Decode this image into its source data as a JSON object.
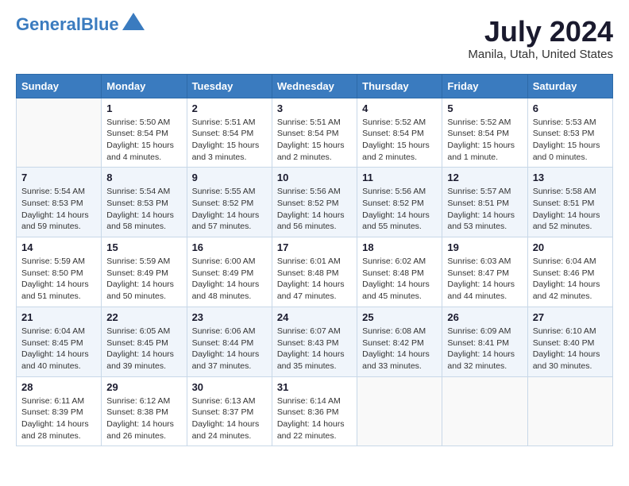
{
  "header": {
    "logo_general": "General",
    "logo_blue": "Blue",
    "month_year": "July 2024",
    "location": "Manila, Utah, United States"
  },
  "weekdays": [
    "Sunday",
    "Monday",
    "Tuesday",
    "Wednesday",
    "Thursday",
    "Friday",
    "Saturday"
  ],
  "weeks": [
    [
      {
        "day": "",
        "sunrise": "",
        "sunset": "",
        "daylight": ""
      },
      {
        "day": "1",
        "sunrise": "Sunrise: 5:50 AM",
        "sunset": "Sunset: 8:54 PM",
        "daylight": "Daylight: 15 hours and 4 minutes."
      },
      {
        "day": "2",
        "sunrise": "Sunrise: 5:51 AM",
        "sunset": "Sunset: 8:54 PM",
        "daylight": "Daylight: 15 hours and 3 minutes."
      },
      {
        "day": "3",
        "sunrise": "Sunrise: 5:51 AM",
        "sunset": "Sunset: 8:54 PM",
        "daylight": "Daylight: 15 hours and 2 minutes."
      },
      {
        "day": "4",
        "sunrise": "Sunrise: 5:52 AM",
        "sunset": "Sunset: 8:54 PM",
        "daylight": "Daylight: 15 hours and 2 minutes."
      },
      {
        "day": "5",
        "sunrise": "Sunrise: 5:52 AM",
        "sunset": "Sunset: 8:54 PM",
        "daylight": "Daylight: 15 hours and 1 minute."
      },
      {
        "day": "6",
        "sunrise": "Sunrise: 5:53 AM",
        "sunset": "Sunset: 8:53 PM",
        "daylight": "Daylight: 15 hours and 0 minutes."
      }
    ],
    [
      {
        "day": "7",
        "sunrise": "Sunrise: 5:54 AM",
        "sunset": "Sunset: 8:53 PM",
        "daylight": "Daylight: 14 hours and 59 minutes."
      },
      {
        "day": "8",
        "sunrise": "Sunrise: 5:54 AM",
        "sunset": "Sunset: 8:53 PM",
        "daylight": "Daylight: 14 hours and 58 minutes."
      },
      {
        "day": "9",
        "sunrise": "Sunrise: 5:55 AM",
        "sunset": "Sunset: 8:52 PM",
        "daylight": "Daylight: 14 hours and 57 minutes."
      },
      {
        "day": "10",
        "sunrise": "Sunrise: 5:56 AM",
        "sunset": "Sunset: 8:52 PM",
        "daylight": "Daylight: 14 hours and 56 minutes."
      },
      {
        "day": "11",
        "sunrise": "Sunrise: 5:56 AM",
        "sunset": "Sunset: 8:52 PM",
        "daylight": "Daylight: 14 hours and 55 minutes."
      },
      {
        "day": "12",
        "sunrise": "Sunrise: 5:57 AM",
        "sunset": "Sunset: 8:51 PM",
        "daylight": "Daylight: 14 hours and 53 minutes."
      },
      {
        "day": "13",
        "sunrise": "Sunrise: 5:58 AM",
        "sunset": "Sunset: 8:51 PM",
        "daylight": "Daylight: 14 hours and 52 minutes."
      }
    ],
    [
      {
        "day": "14",
        "sunrise": "Sunrise: 5:59 AM",
        "sunset": "Sunset: 8:50 PM",
        "daylight": "Daylight: 14 hours and 51 minutes."
      },
      {
        "day": "15",
        "sunrise": "Sunrise: 5:59 AM",
        "sunset": "Sunset: 8:49 PM",
        "daylight": "Daylight: 14 hours and 50 minutes."
      },
      {
        "day": "16",
        "sunrise": "Sunrise: 6:00 AM",
        "sunset": "Sunset: 8:49 PM",
        "daylight": "Daylight: 14 hours and 48 minutes."
      },
      {
        "day": "17",
        "sunrise": "Sunrise: 6:01 AM",
        "sunset": "Sunset: 8:48 PM",
        "daylight": "Daylight: 14 hours and 47 minutes."
      },
      {
        "day": "18",
        "sunrise": "Sunrise: 6:02 AM",
        "sunset": "Sunset: 8:48 PM",
        "daylight": "Daylight: 14 hours and 45 minutes."
      },
      {
        "day": "19",
        "sunrise": "Sunrise: 6:03 AM",
        "sunset": "Sunset: 8:47 PM",
        "daylight": "Daylight: 14 hours and 44 minutes."
      },
      {
        "day": "20",
        "sunrise": "Sunrise: 6:04 AM",
        "sunset": "Sunset: 8:46 PM",
        "daylight": "Daylight: 14 hours and 42 minutes."
      }
    ],
    [
      {
        "day": "21",
        "sunrise": "Sunrise: 6:04 AM",
        "sunset": "Sunset: 8:45 PM",
        "daylight": "Daylight: 14 hours and 40 minutes."
      },
      {
        "day": "22",
        "sunrise": "Sunrise: 6:05 AM",
        "sunset": "Sunset: 8:45 PM",
        "daylight": "Daylight: 14 hours and 39 minutes."
      },
      {
        "day": "23",
        "sunrise": "Sunrise: 6:06 AM",
        "sunset": "Sunset: 8:44 PM",
        "daylight": "Daylight: 14 hours and 37 minutes."
      },
      {
        "day": "24",
        "sunrise": "Sunrise: 6:07 AM",
        "sunset": "Sunset: 8:43 PM",
        "daylight": "Daylight: 14 hours and 35 minutes."
      },
      {
        "day": "25",
        "sunrise": "Sunrise: 6:08 AM",
        "sunset": "Sunset: 8:42 PM",
        "daylight": "Daylight: 14 hours and 33 minutes."
      },
      {
        "day": "26",
        "sunrise": "Sunrise: 6:09 AM",
        "sunset": "Sunset: 8:41 PM",
        "daylight": "Daylight: 14 hours and 32 minutes."
      },
      {
        "day": "27",
        "sunrise": "Sunrise: 6:10 AM",
        "sunset": "Sunset: 8:40 PM",
        "daylight": "Daylight: 14 hours and 30 minutes."
      }
    ],
    [
      {
        "day": "28",
        "sunrise": "Sunrise: 6:11 AM",
        "sunset": "Sunset: 8:39 PM",
        "daylight": "Daylight: 14 hours and 28 minutes."
      },
      {
        "day": "29",
        "sunrise": "Sunrise: 6:12 AM",
        "sunset": "Sunset: 8:38 PM",
        "daylight": "Daylight: 14 hours and 26 minutes."
      },
      {
        "day": "30",
        "sunrise": "Sunrise: 6:13 AM",
        "sunset": "Sunset: 8:37 PM",
        "daylight": "Daylight: 14 hours and 24 minutes."
      },
      {
        "day": "31",
        "sunrise": "Sunrise: 6:14 AM",
        "sunset": "Sunset: 8:36 PM",
        "daylight": "Daylight: 14 hours and 22 minutes."
      },
      {
        "day": "",
        "sunrise": "",
        "sunset": "",
        "daylight": ""
      },
      {
        "day": "",
        "sunrise": "",
        "sunset": "",
        "daylight": ""
      },
      {
        "day": "",
        "sunrise": "",
        "sunset": "",
        "daylight": ""
      }
    ]
  ]
}
